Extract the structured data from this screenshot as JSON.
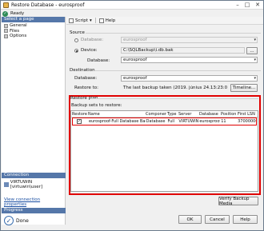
{
  "window": {
    "title": "Restore Database - eurosproof",
    "minimize_glyph": "–",
    "maximize_glyph": "□",
    "close_glyph": "✕"
  },
  "status": {
    "text": "Ready"
  },
  "select_page": {
    "header": "Select a page",
    "items": [
      "General",
      "Files",
      "Options"
    ]
  },
  "toolbar": {
    "script_label": "Script",
    "help_label": "Help",
    "dropdown_glyph": "▾"
  },
  "source": {
    "title": "Source",
    "database_label": "Database:",
    "database_value": "eurosproof",
    "device_label": "Device:",
    "device_value": "C:\\SQLBackup\\i.db.bak",
    "browse_label": "...",
    "db_label": "Database:",
    "db_value": "eurosproof"
  },
  "destination": {
    "title": "Destination",
    "database_label": "Database:",
    "database_value": "eurosproof",
    "restore_to_label": "Restore to:",
    "restore_to_value": "The last backup taken (2019. június 24.13:23:09)",
    "timeline_label": "Timeline..."
  },
  "restore_plan": {
    "title": "Restore plan",
    "subtitle": "Backup sets to restore:",
    "columns": [
      "Restore",
      "Name",
      "Component",
      "Type",
      "Server",
      "Database",
      "Position",
      "First LSN"
    ],
    "rows": [
      {
        "restore": "✓",
        "name": "eurosproof-Full Database Backup",
        "component": "Database",
        "type": "Full",
        "server": "VIRTUWIN",
        "database": "eurosproof",
        "position": "11",
        "first_lsn": "37000000"
      }
    ],
    "verify_label": "Verify Backup Media"
  },
  "connection": {
    "header": "Connection",
    "server_user": "VIRTUWIN [virtuwin\\user]",
    "view_link": "View connection properties"
  },
  "progress": {
    "header": "Progress",
    "status": "Done"
  },
  "footer": {
    "ok_label": "OK",
    "cancel_label": "Cancel",
    "help_label": "Help"
  }
}
